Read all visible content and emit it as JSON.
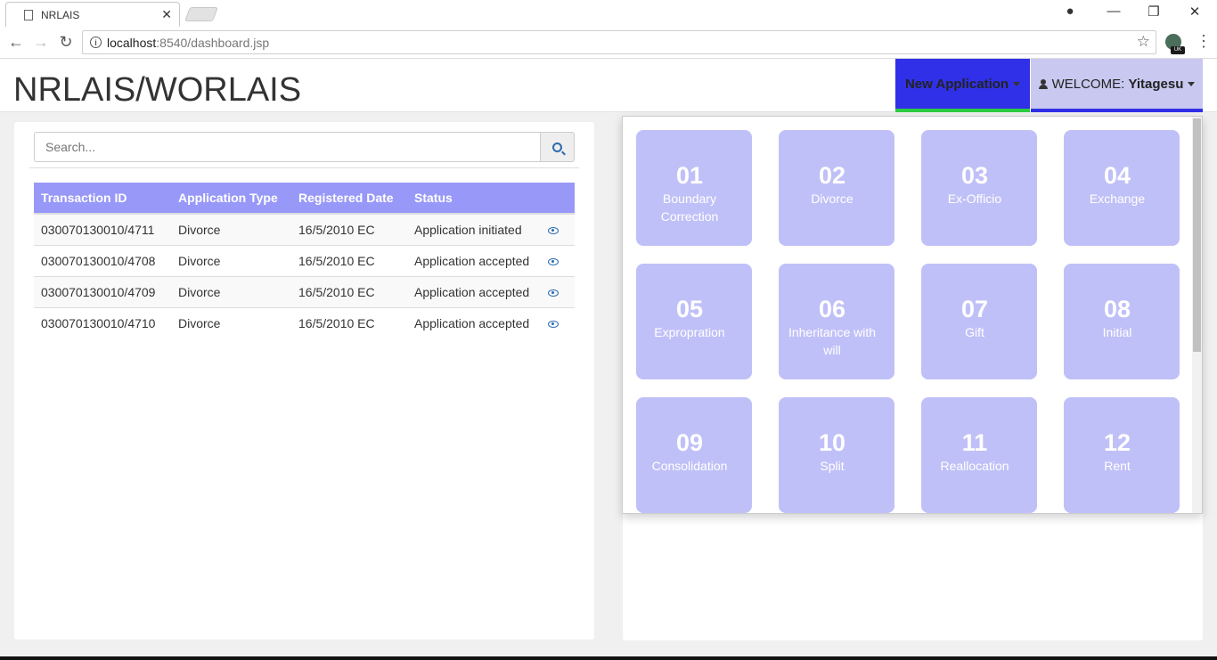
{
  "browser": {
    "tab_title": "NRLAIS",
    "url_host": "localhost",
    "url_rest": ":8540/dashboard.jsp",
    "ext_badge": "UK"
  },
  "header": {
    "brand": "NRLAIS/WORLAIS",
    "new_application": "New Application",
    "welcome_prefix": "WELCOME: ",
    "username": "Yitagesu"
  },
  "search": {
    "placeholder": "Search..."
  },
  "table": {
    "headers": [
      "Transaction ID",
      "Application Type",
      "Registered Date",
      "Status"
    ],
    "rows": [
      {
        "id": "030070130010/4711",
        "type": "Divorce",
        "date": "16/5/2010 EC",
        "status": "Application initiated"
      },
      {
        "id": "030070130010/4708",
        "type": "Divorce",
        "date": "16/5/2010 EC",
        "status": "Application accepted"
      },
      {
        "id": "030070130010/4709",
        "type": "Divorce",
        "date": "16/5/2010 EC",
        "status": "Application accepted"
      },
      {
        "id": "030070130010/4710",
        "type": "Divorce",
        "date": "16/5/2010 EC",
        "status": "Application accepted"
      }
    ]
  },
  "tiles": [
    {
      "num": "01",
      "label": "Boundary Correction"
    },
    {
      "num": "02",
      "label": "Divorce"
    },
    {
      "num": "03",
      "label": "Ex-Officio"
    },
    {
      "num": "04",
      "label": "Exchange"
    },
    {
      "num": "05",
      "label": "Expropration"
    },
    {
      "num": "06",
      "label": "Inheritance with will"
    },
    {
      "num": "07",
      "label": "Gift"
    },
    {
      "num": "08",
      "label": "Initial"
    },
    {
      "num": "09",
      "label": "Consolidation"
    },
    {
      "num": "10",
      "label": "Split"
    },
    {
      "num": "11",
      "label": "Reallocation"
    },
    {
      "num": "12",
      "label": "Rent"
    }
  ],
  "colors": {
    "new_application_bg": "#3030e8",
    "welcome_bg": "#c8c8f0",
    "table_header_bg": "#9898f8",
    "tile_bg": "#c0c0f8",
    "accent_green": "#2ecc40"
  }
}
